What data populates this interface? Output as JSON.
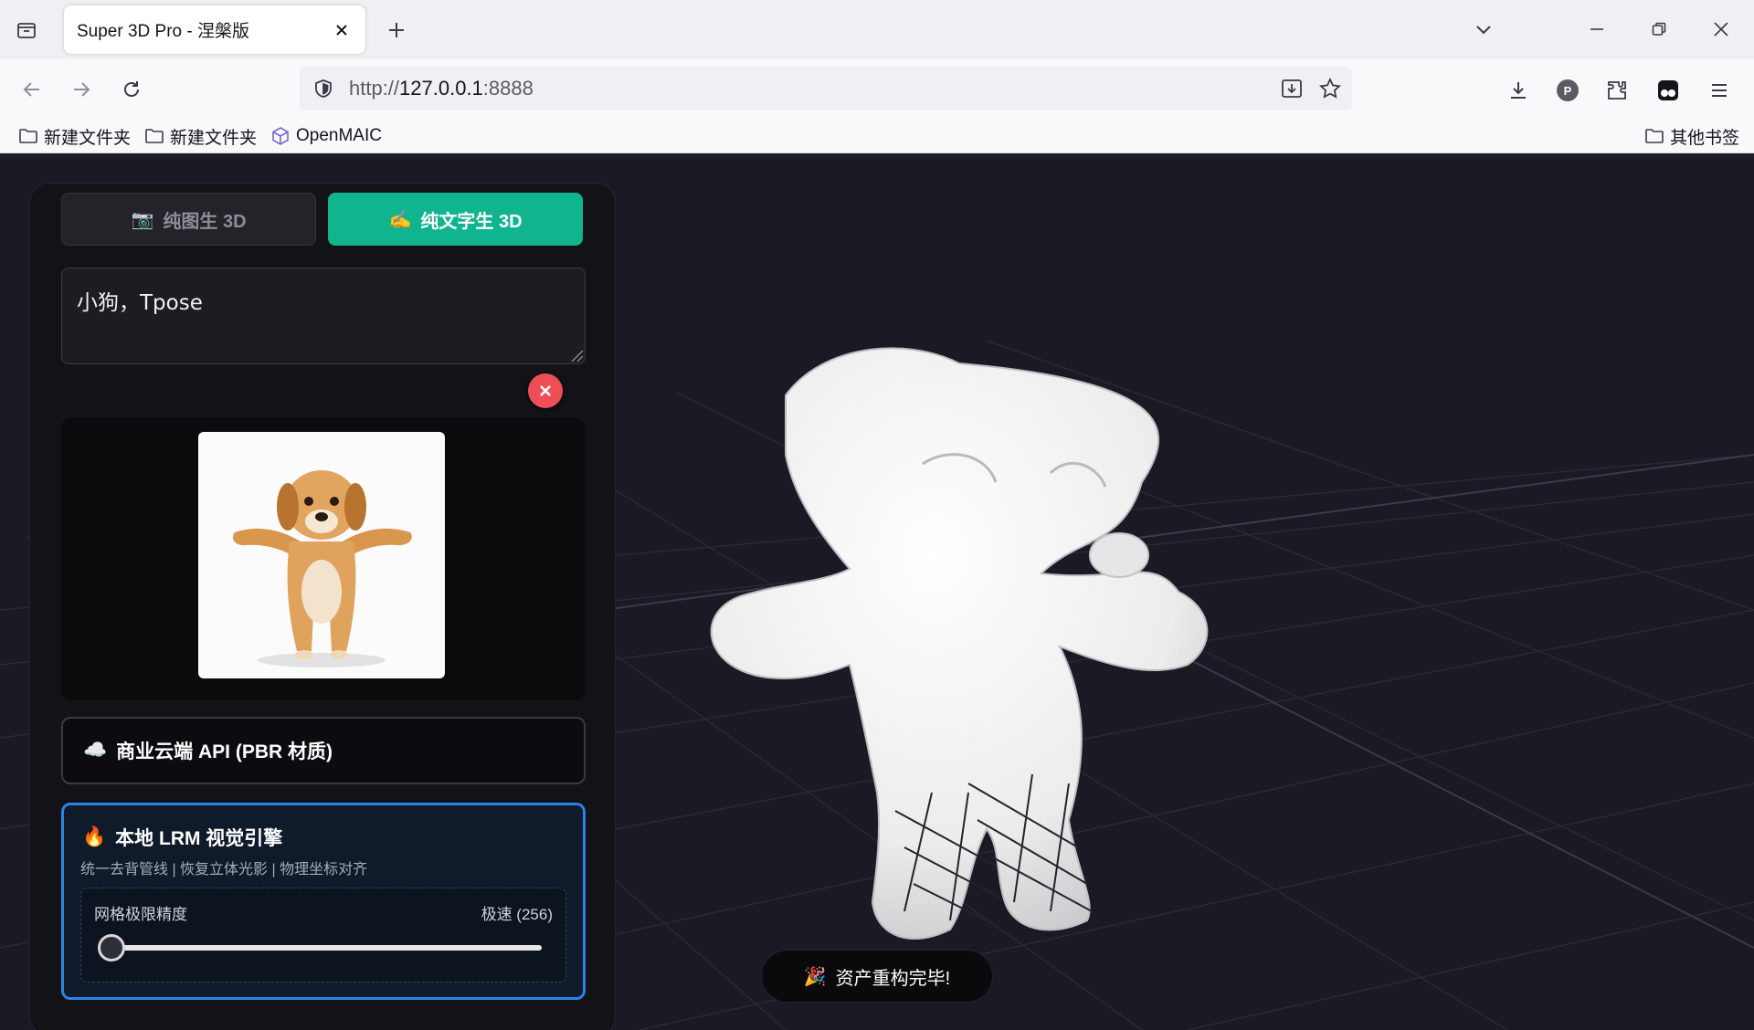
{
  "browser": {
    "tab_title": "Super 3D Pro - 涅槃版",
    "url_prefix": "http://",
    "url_host": "127.0.0.1",
    "url_suffix": ":8888",
    "profile_initial": "P",
    "bookmarks": [
      {
        "label": "新建文件夹",
        "icon": "folder-icon"
      },
      {
        "label": "新建文件夹",
        "icon": "folder-icon"
      },
      {
        "label": "OpenMAIC",
        "icon": "openmaic-logo-icon"
      }
    ],
    "other_bookmarks": "其他书签"
  },
  "app": {
    "mode_tabs": [
      {
        "icon": "📷",
        "label": "纯图生 3D",
        "active": false
      },
      {
        "icon": "✍️",
        "label": "纯文字生 3D",
        "active": true
      }
    ],
    "prompt_value": "小狗，Tpose",
    "engines": {
      "cloud": {
        "icon": "☁️",
        "label": "商业云端 API (PBR 材质)"
      },
      "local": {
        "icon": "🔥",
        "label": "本地 LRM 视觉引擎",
        "subtitle": "统一去背管线 | 恢复立体光影 | 物理坐标对齐",
        "slider_label": "网格极限精度",
        "slider_value_text": "极速 (256)",
        "slider_level": 0.0
      }
    },
    "toast": {
      "icon": "🎉",
      "text": "资产重构完毕!"
    }
  },
  "colors": {
    "accent_green": "#10b48e",
    "accent_blue": "#2a83e6",
    "danger": "#f04e57",
    "scene_bg": "#1a1a24"
  }
}
